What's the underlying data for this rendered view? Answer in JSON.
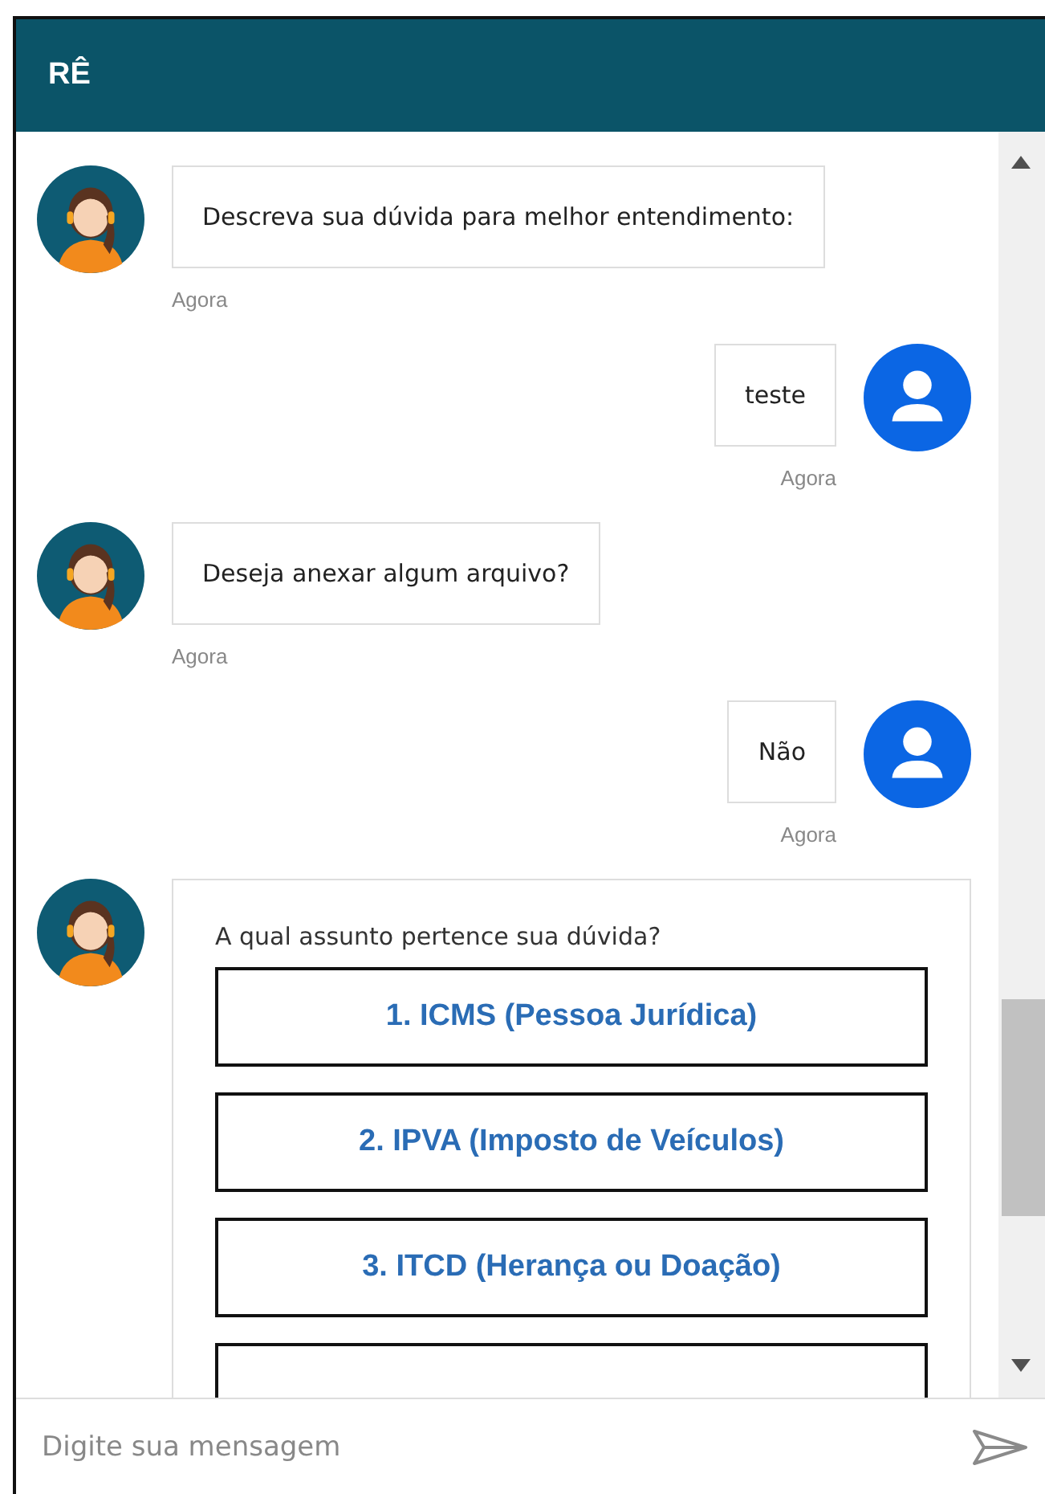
{
  "header": {
    "title": "RÊ"
  },
  "messages": [
    {
      "kind": "bot",
      "text": "Descreva sua dúvida para melhor entendimento:",
      "time": "Agora"
    },
    {
      "kind": "user",
      "text": "teste",
      "time": "Agora"
    },
    {
      "kind": "bot",
      "text": "Deseja anexar algum arquivo?",
      "time": "Agora"
    },
    {
      "kind": "user",
      "text": "Não",
      "time": "Agora"
    },
    {
      "kind": "bot_options",
      "text": "A qual assunto pertence sua dúvida?",
      "options": [
        "1. ICMS (Pessoa Jurídica)",
        "2. IPVA (Imposto de Veículos)",
        "3. ITCD (Herança ou Doação)"
      ]
    }
  ],
  "composer": {
    "placeholder": "Digite sua mensagem"
  }
}
